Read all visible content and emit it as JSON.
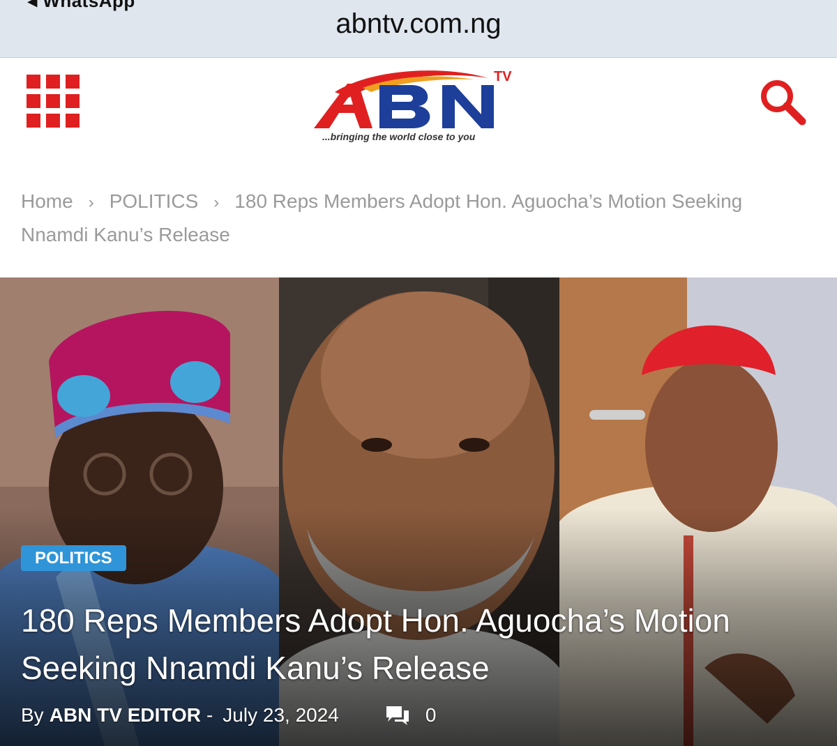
{
  "browser": {
    "back_app_label": "◂ WhatsApp",
    "url": "abntv.com.ng"
  },
  "site": {
    "logo_text": "ABN",
    "logo_tv": "TV",
    "tagline": "...bringing the world close to you",
    "brand_red": "#e02020",
    "brand_blue": "#1d3f9a"
  },
  "breadcrumb": {
    "home": "Home",
    "category": "POLITICS",
    "current_line1": "180 Reps Members Adopt Hon. Aguocha’s Motion Seeking",
    "current_line2": "Nnamdi Kanu’s Release",
    "separator": "›"
  },
  "article": {
    "category_badge": "POLITICS",
    "badge_color": "#2f95d8",
    "title": "180 Reps Members Adopt Hon. Aguocha’s Motion Seeking Nnamdi Kanu’s Release",
    "by_label": "By",
    "author": "ABN TV EDITOR",
    "dash": "-",
    "date": "July 23, 2024",
    "comment_count": "0"
  },
  "icons": {
    "menu": "grid-menu-icon",
    "search": "search-icon",
    "comments": "comments-icon"
  }
}
